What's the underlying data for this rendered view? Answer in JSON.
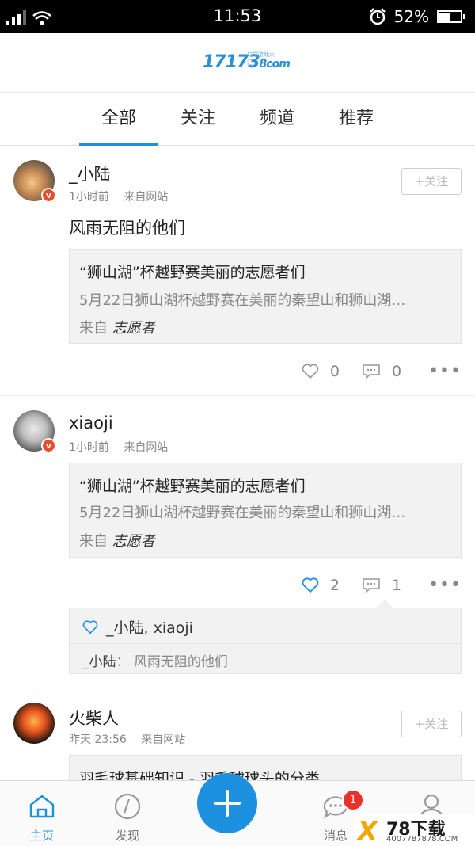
{
  "status_bar": {
    "time": "11:53",
    "battery": "52%",
    "battery_level": 0.52
  },
  "header": {
    "logo_text": "17173",
    "logo_domain": "8com",
    "logo_sub": "口袋游戏大汇"
  },
  "tabs": [
    {
      "label": "全部",
      "active": true
    },
    {
      "label": "关注",
      "active": false
    },
    {
      "label": "频道",
      "active": false
    },
    {
      "label": "推荐",
      "active": false
    }
  ],
  "posts": [
    {
      "username": "_小陆",
      "time": "1小时前",
      "source": "来自网站",
      "follow_label": "+关注",
      "text": "风雨无阻的他们",
      "card": {
        "title": "“狮山湖”杯越野赛美丽的志愿者们",
        "desc": "5月22日狮山湖杯越野赛在美丽的秦望山和狮山湖…",
        "from_prefix": "来自",
        "from_name": "志愿者"
      },
      "likes": "0",
      "comments": "0"
    },
    {
      "username": "xiaoji",
      "time": "1小时前",
      "source": "来自网站",
      "card": {
        "title": "“狮山湖”杯越野赛美丽的志愿者们",
        "desc": "5月22日狮山湖杯越野赛在美丽的秦望山和狮山湖…",
        "from_prefix": "来自",
        "from_name": "志愿者"
      },
      "likes": "2",
      "comments": "1",
      "liked_by": "_小陆, xiaoji",
      "comment": {
        "author": "_小陆",
        "sep": "：",
        "text": "风雨无阻的他们"
      }
    },
    {
      "username": "火柴人",
      "time": "昨天 23:56",
      "source": "来自网站",
      "follow_label": "+关注",
      "card": {
        "title": "羽毛球基础知识 - 羽毛球球头的分类"
      }
    }
  ],
  "bottom_nav": {
    "home": "主页",
    "discover": "发现",
    "messages": "消息",
    "messages_badge": "1",
    "profile": ""
  },
  "watermark": {
    "brand": "78下载",
    "url": "4007787878.COM"
  },
  "colors": {
    "accent": "#1e90e0",
    "badge": "#e8332a",
    "verified": "#e84e2a"
  }
}
